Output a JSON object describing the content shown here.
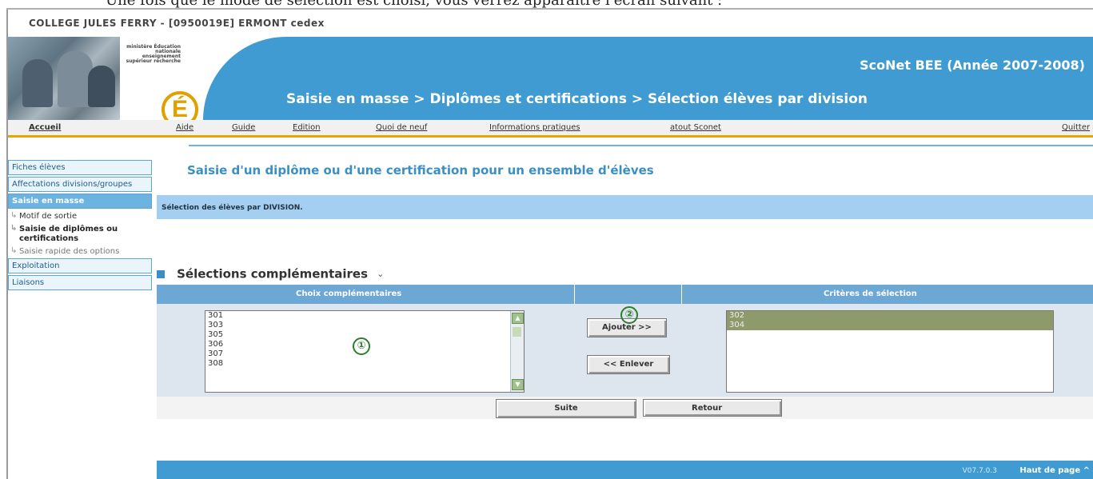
{
  "caption": "Une fois que le mode de sélection est choisi, vous verrez apparaître l'écran suivant :",
  "window_title": "COLLEGE JULES FERRY - [0950019E] ERMONT cedex",
  "header": {
    "ministry": "ministère Éducation nationale enseignement supérieur recherche",
    "logo_letter": "É",
    "app_name": "ScoNet BEE (Année 2007-2008)",
    "breadcrumb": "Saisie en masse > Diplômes et certifications > Sélection élèves par division"
  },
  "menu": {
    "home": "Accueil",
    "items": [
      "Aide",
      "Guide",
      "Edition",
      "Quoi de neuf",
      "Informations pratiques",
      "atout Sconet"
    ],
    "quit": "Quitter"
  },
  "sidebar": {
    "fiches": "Fiches élèves",
    "affectations": "Affectations divisions/groupes",
    "saisie_masse": "Saisie en masse",
    "motif": "Motif de sortie",
    "diplomes": "Saisie de diplômes ou certifications",
    "rapide": "Saisie rapide des options",
    "exploitation": "Exploitation",
    "liaisons": "Liaisons"
  },
  "main": {
    "title": "Saisie d'un diplôme ou d'une certification pour un ensemble d'élèves",
    "selection_label": "Sélection des élèves par DIVISION.",
    "section_title": "Sélections complémentaires",
    "section_chevron": "⌄",
    "col_choices": "Choix complémentaires",
    "col_criteria": "Critères de sélection",
    "choices": [
      "301",
      "303",
      "305",
      "306",
      "307",
      "308"
    ],
    "criteria": [
      "302",
      "304"
    ],
    "add_label": "Ajouter >>",
    "remove_label": "<< Enlever",
    "marker_1": "①",
    "marker_2": "②",
    "suite_label": "Suite",
    "retour_label": "Retour"
  },
  "footer": {
    "version": "V07.7.0.3",
    "top_link": "Haut de page ^"
  },
  "colors": {
    "header_blue": "#3f9bd1",
    "accent_orange": "#e8a400",
    "selected_olive": "#8e9a6a",
    "marker_green": "#2c7d2c"
  }
}
